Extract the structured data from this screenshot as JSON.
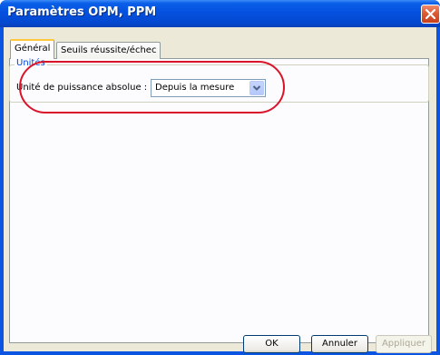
{
  "window": {
    "title": "Paramètres OPM, PPM"
  },
  "tabs": [
    {
      "label": "Général"
    },
    {
      "label": "Seuils réussite/échec"
    }
  ],
  "units_group": {
    "legend": "Unités",
    "field_label": "Unité de puissance absolue :",
    "select_value": "Depuis la mesure"
  },
  "buttons": {
    "ok": "OK",
    "cancel": "Annuler",
    "apply": "Appliquer"
  },
  "icons": {
    "close": "close-icon",
    "dropdown": "chevron-down-icon"
  },
  "colors": {
    "title_bar": "#0551df",
    "highlight": "#d9142a",
    "legend": "#0046d5"
  }
}
